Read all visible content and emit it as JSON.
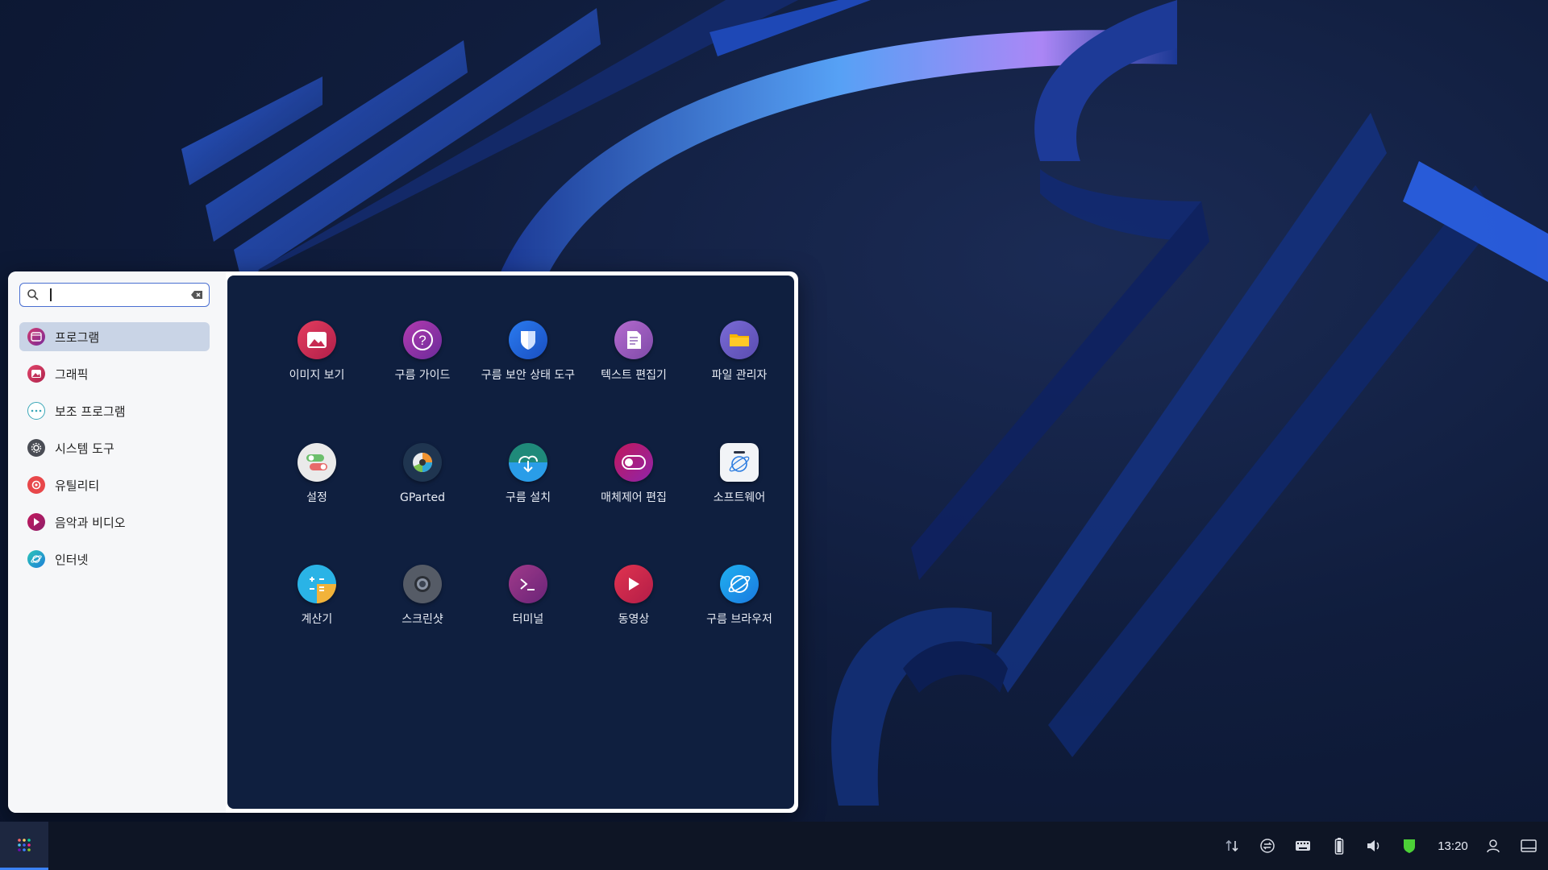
{
  "search": {
    "placeholder": "",
    "value": ""
  },
  "categories": [
    {
      "label": "프로그램",
      "icon": "programs-icon",
      "active": true
    },
    {
      "label": "그래픽",
      "icon": "graphics-icon"
    },
    {
      "label": "보조 프로그램",
      "icon": "accessories-icon"
    },
    {
      "label": "시스템 도구",
      "icon": "system-tools-icon"
    },
    {
      "label": "유틸리티",
      "icon": "utilities-icon"
    },
    {
      "label": "음악과 비디오",
      "icon": "music-video-icon"
    },
    {
      "label": "인터넷",
      "icon": "internet-icon"
    }
  ],
  "apps": [
    {
      "label": "이미지 보기",
      "icon": "image-viewer-icon"
    },
    {
      "label": "구름 가이드",
      "icon": "help-guide-icon"
    },
    {
      "label": "구름 보안 상태 도구",
      "icon": "security-shield-icon"
    },
    {
      "label": "텍스트 편집기",
      "icon": "text-editor-icon"
    },
    {
      "label": "파일 관리자",
      "icon": "folder-icon"
    },
    {
      "label": "설정",
      "icon": "settings-toggles-icon"
    },
    {
      "label": "GParted",
      "icon": "gparted-icon"
    },
    {
      "label": "구름 설치",
      "icon": "installer-icon"
    },
    {
      "label": "매체제어 편집",
      "icon": "media-control-toggle-icon"
    },
    {
      "label": "소프트웨어",
      "icon": "software-store-icon"
    },
    {
      "label": "계산기",
      "icon": "calculator-icon"
    },
    {
      "label": "스크린샷",
      "icon": "screenshot-icon"
    },
    {
      "label": "터미널",
      "icon": "terminal-icon"
    },
    {
      "label": "동영상",
      "icon": "video-player-icon"
    },
    {
      "label": "구름 브라우저",
      "icon": "browser-icon"
    }
  ],
  "taskbar": {
    "start_icon": "app-grid-icon",
    "tray": [
      "network-transfer-icon",
      "sync-icon",
      "keyboard-icon",
      "battery-icon",
      "volume-icon",
      "security-shield-icon",
      "user-icon",
      "show-desktop-icon"
    ],
    "clock": "13:20"
  }
}
